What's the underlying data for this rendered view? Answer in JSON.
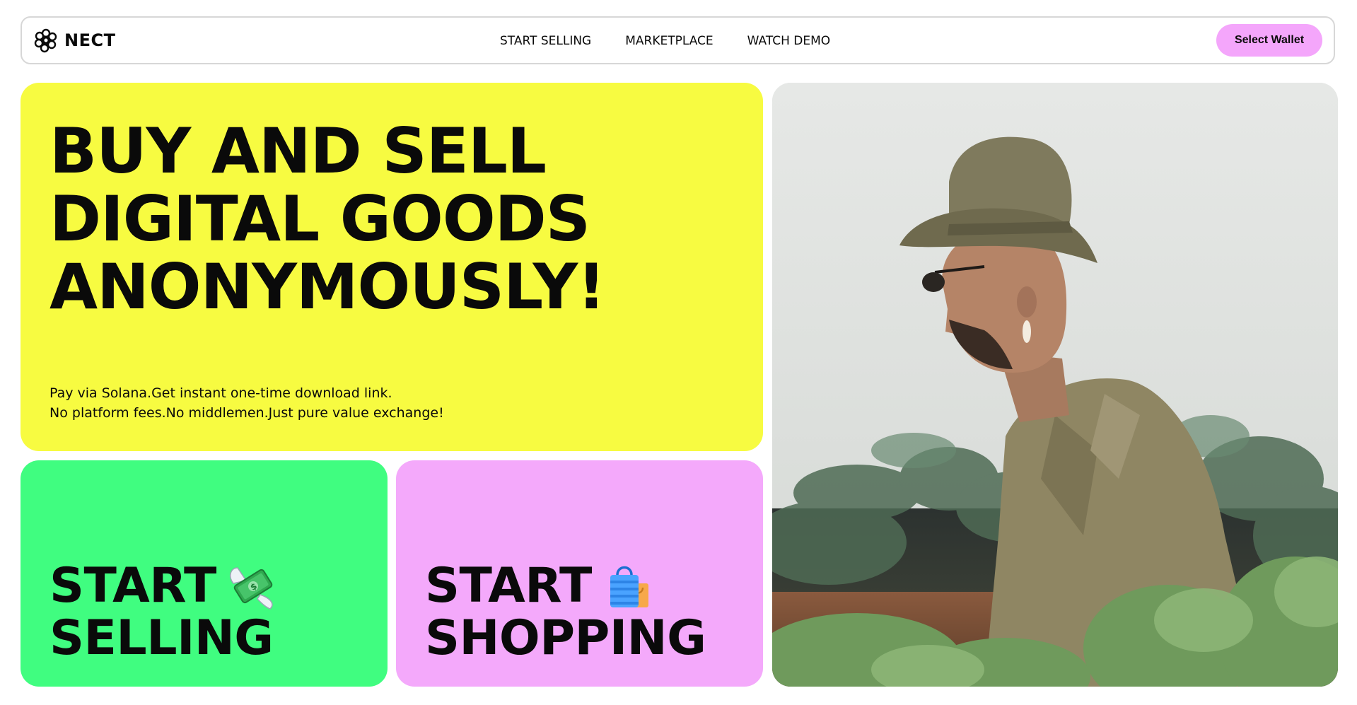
{
  "brand": {
    "name": "NECT",
    "icon": "flower-gear-icon"
  },
  "nav": {
    "links": [
      "START SELLING",
      "MARKETPLACE",
      "WATCH DEMO"
    ]
  },
  "wallet_button": {
    "label": "Select Wallet",
    "color": "#f4a6fb"
  },
  "hero": {
    "title_lines": [
      "BUY AND SELL",
      "DIGITAL GOODS",
      "ANONYMOUSLY!"
    ],
    "subtitle_lines": [
      "Pay via Solana.Get instant one-time download link.",
      "No platform fees.No middlemen.Just pure value exchange!"
    ],
    "background": "#f7fb41"
  },
  "sell_card": {
    "line1": "START",
    "line2": "SELLING",
    "icon": "money-with-wings-icon",
    "background": "#40fd80"
  },
  "shop_card": {
    "line1": "START",
    "line2": "SHOPPING",
    "icon": "shopping-bags-icon",
    "background": "#f4a9fb"
  },
  "photo": {
    "description_icon": "person-bucket-hat-photo"
  }
}
